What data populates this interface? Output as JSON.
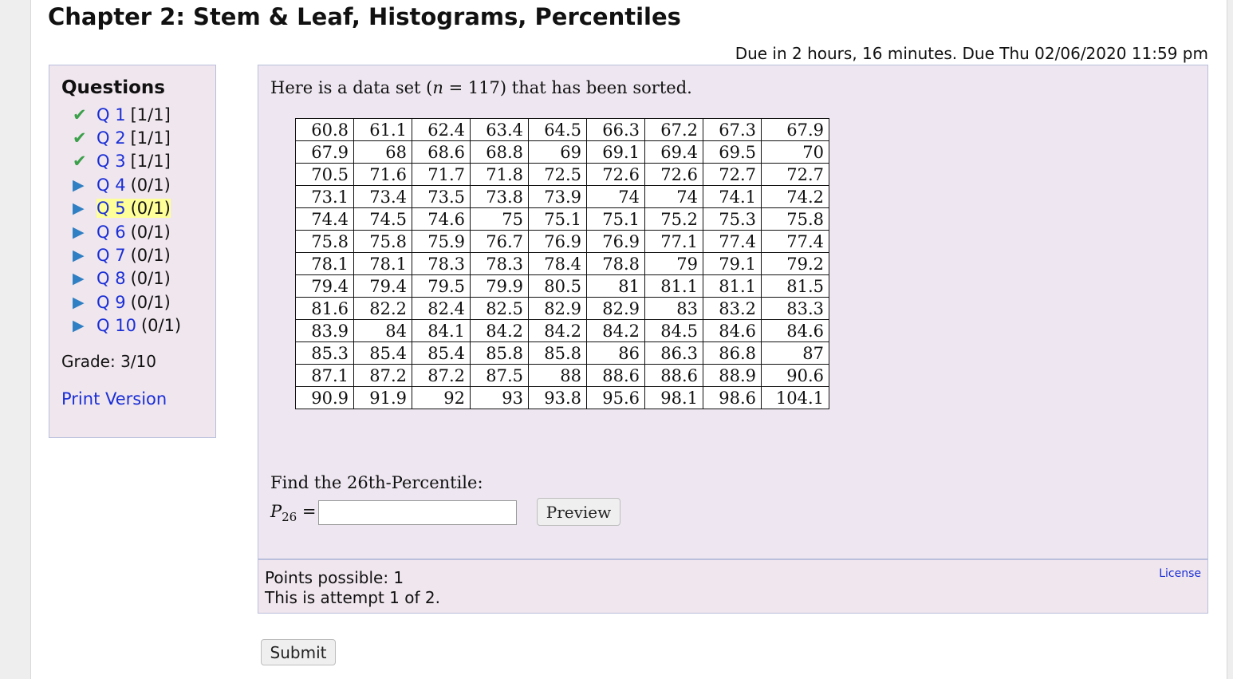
{
  "page": {
    "title": "Chapter 2: Stem & Leaf, Histograms, Percentiles",
    "due": "Due in 2 hours, 16 minutes. Due Thu 02/06/2020 11:59 pm"
  },
  "sidebar": {
    "heading": "Questions",
    "questions": [
      {
        "label": "Q 1",
        "score": "[1/1]",
        "status": "check-icon"
      },
      {
        "label": "Q 2",
        "score": "[1/1]",
        "status": "check-icon"
      },
      {
        "label": "Q 3",
        "score": "[1/1]",
        "status": "check-icon"
      },
      {
        "label": "Q 4",
        "score": "(0/1)",
        "status": "arrow-icon"
      },
      {
        "label": "Q 5",
        "score": "(0/1)",
        "status": "arrow-icon",
        "current": true
      },
      {
        "label": "Q 6",
        "score": "(0/1)",
        "status": "arrow-icon"
      },
      {
        "label": "Q 7",
        "score": "(0/1)",
        "status": "arrow-icon"
      },
      {
        "label": "Q 8",
        "score": "(0/1)",
        "status": "arrow-icon"
      },
      {
        "label": "Q 9",
        "score": "(0/1)",
        "status": "arrow-icon"
      },
      {
        "label": "Q 10",
        "score": "(0/1)",
        "status": "arrow-icon"
      }
    ],
    "grade": "Grade: 3/10",
    "print_label": "Print Version"
  },
  "question": {
    "intro_before": "Here is a data set (",
    "intro_var": "n",
    "intro_eq": " = 117",
    "intro_after": ") that has been sorted.",
    "table": [
      [
        "60.8",
        "61.1",
        "62.4",
        "63.4",
        "64.5",
        "66.3",
        "67.2",
        "67.3",
        "67.9"
      ],
      [
        "67.9",
        "68",
        "68.6",
        "68.8",
        "69",
        "69.1",
        "69.4",
        "69.5",
        "70"
      ],
      [
        "70.5",
        "71.6",
        "71.7",
        "71.8",
        "72.5",
        "72.6",
        "72.6",
        "72.7",
        "72.7"
      ],
      [
        "73.1",
        "73.4",
        "73.5",
        "73.8",
        "73.9",
        "74",
        "74",
        "74.1",
        "74.2"
      ],
      [
        "74.4",
        "74.5",
        "74.6",
        "75",
        "75.1",
        "75.1",
        "75.2",
        "75.3",
        "75.8"
      ],
      [
        "75.8",
        "75.8",
        "75.9",
        "76.7",
        "76.9",
        "76.9",
        "77.1",
        "77.4",
        "77.4"
      ],
      [
        "78.1",
        "78.1",
        "78.3",
        "78.3",
        "78.4",
        "78.8",
        "79",
        "79.1",
        "79.2"
      ],
      [
        "79.4",
        "79.4",
        "79.5",
        "79.9",
        "80.5",
        "81",
        "81.1",
        "81.1",
        "81.5"
      ],
      [
        "81.6",
        "82.2",
        "82.4",
        "82.5",
        "82.9",
        "82.9",
        "83",
        "83.2",
        "83.3"
      ],
      [
        "83.9",
        "84",
        "84.1",
        "84.2",
        "84.2",
        "84.2",
        "84.5",
        "84.6",
        "84.6"
      ],
      [
        "85.3",
        "85.4",
        "85.4",
        "85.8",
        "85.8",
        "86",
        "86.3",
        "86.8",
        "87"
      ],
      [
        "87.1",
        "87.2",
        "87.2",
        "87.5",
        "88",
        "88.6",
        "88.6",
        "88.9",
        "90.6"
      ],
      [
        "90.9",
        "91.9",
        "92",
        "93",
        "93.8",
        "95.6",
        "98.1",
        "98.6",
        "104.1"
      ]
    ],
    "prompt": "Find the 26th-Percentile:",
    "answer_var": "P",
    "answer_sub": "26",
    "answer_eq": " =",
    "answer_value": "",
    "preview_label": "Preview"
  },
  "info": {
    "points": "Points possible: 1",
    "attempt": "This is attempt 1 of 2.",
    "license": "License"
  },
  "submit_label": "Submit",
  "colors": {
    "check": "#3aa04a",
    "arrow": "#2f7fc4",
    "link": "#1a2fd6",
    "current_highlight": "#ffff99",
    "panel_bg": "#eee7f1",
    "sidebar_bg": "#f0e6ee"
  }
}
